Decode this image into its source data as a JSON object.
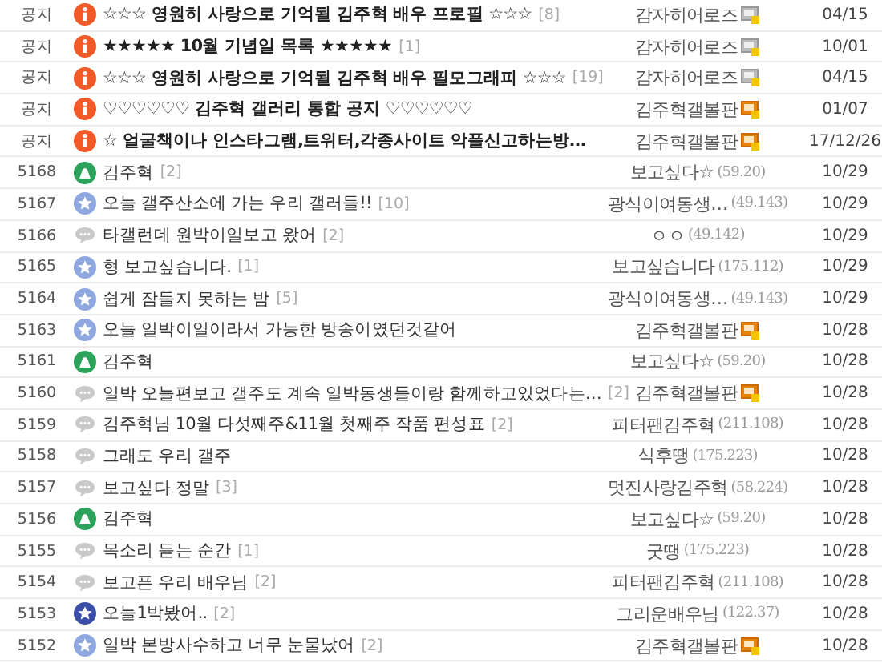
{
  "posts": [
    {
      "number": "공지",
      "kind": "notice",
      "title": "☆☆☆ 영원히 사랑으로 기억될 김주혁 배우 프로필 ☆☆☆",
      "comments": "[8]",
      "writer": "감자히어로즈",
      "badge": {
        "kind": "semi"
      },
      "date": "04/15"
    },
    {
      "number": "공지",
      "kind": "notice",
      "title": "★★★★★ 10월 기념일 목록 ★★★★★",
      "comments": "[1]",
      "writer": "감자히어로즈",
      "badge": {
        "kind": "semi"
      },
      "date": "10/01"
    },
    {
      "number": "공지",
      "kind": "notice",
      "title": "☆☆☆ 영원히 사랑으로 기억될 김주혁 배우 필모그래피 ☆☆☆",
      "comments": "[19]",
      "writer": "감자히어로즈",
      "badge": {
        "kind": "semi"
      },
      "date": "04/15"
    },
    {
      "number": "공지",
      "kind": "notice",
      "title": "♡♡♡♡♡♡ 김주혁 갤러리 통합 공지 ♡♡♡♡♡♡",
      "writer": "김주혁갤볼판",
      "badge": {
        "kind": "fixed"
      },
      "date": "01/07"
    },
    {
      "number": "공지",
      "kind": "notice",
      "title": "☆ 얼굴책이나 인스타그램,트위터,각종사이트 악플신고하는방…",
      "writer": "김주혁갤볼판",
      "badge": {
        "kind": "fixed"
      },
      "date": "17/12/26"
    },
    {
      "number": "5168",
      "kind": "image",
      "title": "김주혁",
      "comments": "[2]",
      "writer": "보고싶다☆",
      "ip": "(59.20)",
      "date": "10/29"
    },
    {
      "number": "5167",
      "kind": "recommended",
      "title": "오늘 갤주산소에 가는 우리 갤러들!!",
      "comments": "[10]",
      "writer": "광식이여동생…",
      "ip": "(49.143)",
      "date": "10/29"
    },
    {
      "number": "5166",
      "kind": "text",
      "title": "타갤런데 원박이일보고 왔어",
      "comments": "[2]",
      "writer": "ㅇㅇ",
      "ip": "(49.142)",
      "date": "10/29"
    },
    {
      "number": "5165",
      "kind": "recommended",
      "title": "형 보고싶습니다.",
      "comments": "[1]",
      "writer": "보고싶습니다",
      "ip": "(175.112)",
      "date": "10/29"
    },
    {
      "number": "5164",
      "kind": "recommended",
      "title": "쉽게 잠들지 못하는 밤",
      "comments": "[5]",
      "writer": "광식이여동생…",
      "ip": "(49.143)",
      "date": "10/29"
    },
    {
      "number": "5163",
      "kind": "recommended",
      "title": "오늘 일박이일이라서 가능한 방송이였던것같어",
      "writer": "김주혁갤볼판",
      "badge": {
        "kind": "fixed"
      },
      "date": "10/28"
    },
    {
      "number": "5161",
      "kind": "image",
      "title": "김주혁",
      "writer": "보고싶다☆",
      "ip": "(59.20)",
      "date": "10/28"
    },
    {
      "number": "5160",
      "kind": "text",
      "title": "일박 오늘편보고 갤주도 계속 일박동생들이랑 함께하고있었다는…",
      "comments": "[2]",
      "writer": "김주혁갤볼판",
      "badge": {
        "kind": "fixed"
      },
      "date": "10/28"
    },
    {
      "number": "5159",
      "kind": "text",
      "title": "김주혁님 10월 다섯째주&11월 첫째주 작품 편성표",
      "comments": "[2]",
      "writer": "피터팬김주혁",
      "ip": "(211.108)",
      "date": "10/28"
    },
    {
      "number": "5158",
      "kind": "text",
      "title": "그래도 우리 갤주",
      "writer": "식후땡",
      "ip": "(175.223)",
      "date": "10/28"
    },
    {
      "number": "5157",
      "kind": "text",
      "title": "보고싶다 정말",
      "comments": "[3]",
      "writer": "멋진사랑김주혁",
      "ip": "(58.224)",
      "date": "10/28"
    },
    {
      "number": "5156",
      "kind": "image",
      "title": "김주혁",
      "writer": "보고싶다☆",
      "ip": "(59.20)",
      "date": "10/28"
    },
    {
      "number": "5155",
      "kind": "text",
      "title": "목소리 듣는 순간",
      "comments": "[1]",
      "writer": "굿땡",
      "ip": "(175.223)",
      "date": "10/28"
    },
    {
      "number": "5154",
      "kind": "text",
      "title": "보고픈 우리 배우님",
      "comments": "[2]",
      "writer": "피터팬김주혁",
      "ip": "(211.108)",
      "date": "10/28"
    },
    {
      "number": "5153",
      "kind": "featured",
      "title": "오늘1박봤어..",
      "comments": "[2]",
      "writer": "그리운배우님",
      "ip": "(122.37)",
      "date": "10/28"
    },
    {
      "number": "5152",
      "kind": "recommended",
      "title": "일박 본방사수하고 너무 눈물났어",
      "comments": "[2]",
      "writer": "김주혁갤볼판",
      "badge": {
        "kind": "fixed"
      },
      "date": "10/28"
    }
  ]
}
